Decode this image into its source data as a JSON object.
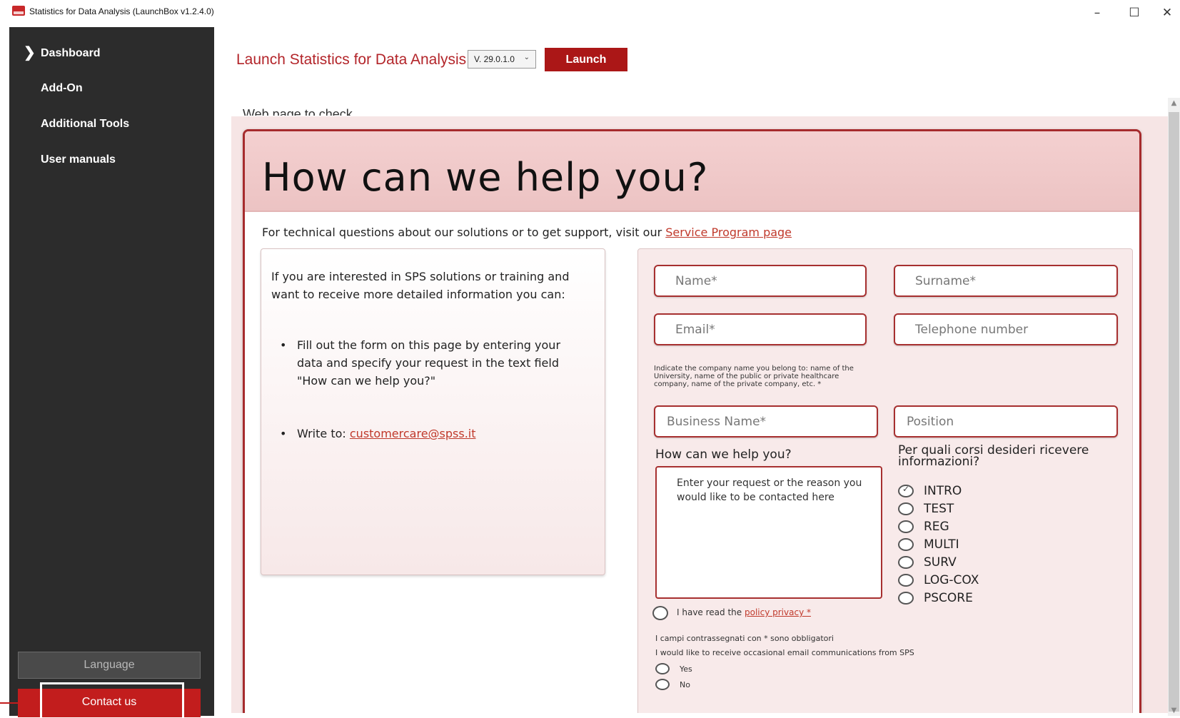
{
  "window": {
    "title": "Statistics for Data Analysis (LaunchBox v1.2.4.0)",
    "controls": {
      "minimize": "–",
      "maximize": "☐",
      "close": "✕"
    },
    "icon": "app-logo-icon"
  },
  "sidebar": {
    "items": [
      {
        "label": "Dashboard",
        "active": true
      },
      {
        "label": "Add-On"
      },
      {
        "label": "Additional Tools"
      },
      {
        "label": "User manuals"
      }
    ],
    "language_label": "Language",
    "contact_label": "Contact us"
  },
  "launch": {
    "label": "Launch Statistics for Data Analysis",
    "version": "V. 29.0.1.0",
    "button": "Launch"
  },
  "webview": {
    "clipped_heading": "Web page to check",
    "title": "How can we help you?",
    "intro_text": "For technical questions about our solutions or to get support, visit our",
    "intro_link": "Service Program page",
    "left": {
      "intro": "If you are interested in SPS solutions or training and want to receive more detailed information you can:",
      "bullet1": "Fill out the form on this page by entering your data and specify your request in the text field \"How can we help you?\"",
      "bullet2_prefix": "Write to:",
      "bullet2_link": "customercare@spss.it"
    },
    "form": {
      "name": "Name*",
      "surname": "Surname*",
      "email": "Email*",
      "telephone": "Telephone number",
      "company_note": "Indicate the company name you belong to: name of the University, name of the public or private healthcare company, name of the private company, etc. *",
      "business": "Business Name*",
      "position": "Position",
      "help_label": "How can we help you?",
      "help_placeholder": "Enter your request or the reason you would like to be contacted here",
      "courses_label": "Per quali corsi desideri ricevere informazioni?",
      "courses": [
        {
          "label": "INTRO",
          "checked": true
        },
        {
          "label": "TEST",
          "checked": false
        },
        {
          "label": "REG",
          "checked": false
        },
        {
          "label": "MULTI",
          "checked": false
        },
        {
          "label": "SURV",
          "checked": false
        },
        {
          "label": "LOG-COX",
          "checked": false
        },
        {
          "label": "PSCORE",
          "checked": false
        }
      ],
      "privacy_prefix": "I have read the",
      "privacy_link": "policy privacy *",
      "required_note": "I campi contrassegnati con * sono obbligatori",
      "email_comm": "I would like to receive occasional email communications from SPS",
      "yes": "Yes",
      "no": "No"
    }
  },
  "colors": {
    "accent": "#ab1717",
    "sidebar_bg": "#2c2c2c",
    "frame_bg": "#f6e5e5",
    "link": "#c0392b"
  }
}
